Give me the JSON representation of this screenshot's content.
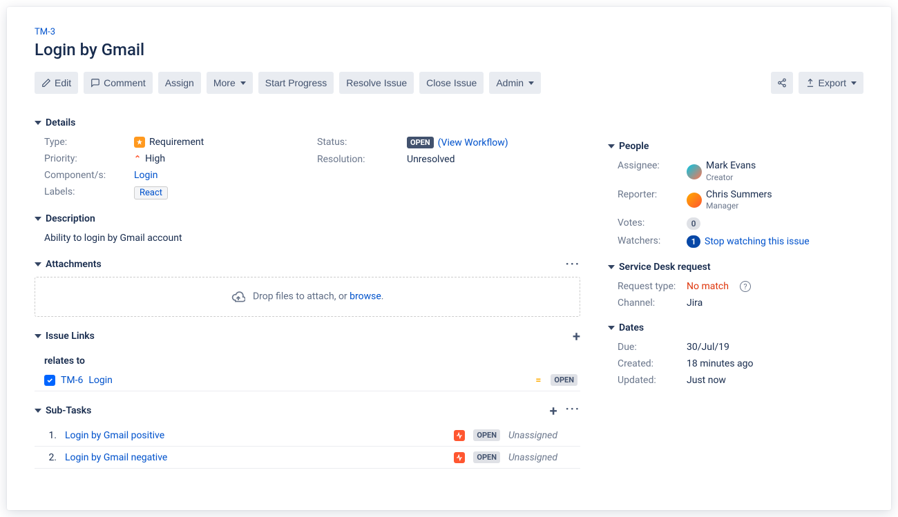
{
  "issue": {
    "key": "TM-3",
    "summary": "Login by Gmail"
  },
  "toolbar": {
    "edit": "Edit",
    "comment": "Comment",
    "assign": "Assign",
    "more": "More",
    "start_progress": "Start Progress",
    "resolve": "Resolve Issue",
    "close": "Close Issue",
    "admin": "Admin",
    "export": "Export"
  },
  "sections": {
    "details": "Details",
    "description": "Description",
    "attachments": "Attachments",
    "issue_links": "Issue Links",
    "subtasks": "Sub-Tasks",
    "people": "People",
    "service_desk": "Service Desk request",
    "dates": "Dates"
  },
  "details": {
    "type_label": "Type:",
    "type_value": "Requirement",
    "priority_label": "Priority:",
    "priority_value": "High",
    "components_label": "Component/s:",
    "components_value": "Login",
    "labels_label": "Labels:",
    "labels_value": "React",
    "status_label": "Status:",
    "status_value": "OPEN",
    "view_workflow": "(View Workflow)",
    "resolution_label": "Resolution:",
    "resolution_value": "Unresolved"
  },
  "description": "Ability to login by Gmail account",
  "attachments": {
    "drop_text": "Drop files to attach, or ",
    "browse": "browse"
  },
  "links": {
    "relates_to": "relates to",
    "items": [
      {
        "key": "TM-6",
        "text": "Login",
        "status": "OPEN"
      }
    ]
  },
  "subtasks": [
    {
      "num": "1.",
      "text": "Login by Gmail positive",
      "status": "OPEN",
      "assignee": "Unassigned"
    },
    {
      "num": "2.",
      "text": "Login by Gmail negative",
      "status": "OPEN",
      "assignee": "Unassigned"
    }
  ],
  "people": {
    "assignee_label": "Assignee:",
    "assignee_name": "Mark Evans",
    "assignee_role": "Creator",
    "reporter_label": "Reporter:",
    "reporter_name": "Chris Summers",
    "reporter_role": "Manager",
    "votes_label": "Votes:",
    "votes": "0",
    "watchers_label": "Watchers:",
    "watchers": "1",
    "stop_watching": "Stop watching this issue"
  },
  "service_desk": {
    "request_type_label": "Request type:",
    "request_type_value": "No match",
    "channel_label": "Channel:",
    "channel_value": "Jira"
  },
  "dates": {
    "due_label": "Due:",
    "due_value": "30/Jul/19",
    "created_label": "Created:",
    "created_value": "18 minutes ago",
    "updated_label": "Updated:",
    "updated_value": "Just now"
  }
}
